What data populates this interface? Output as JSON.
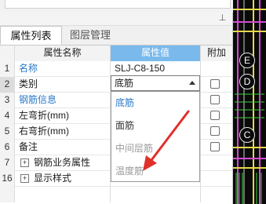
{
  "panel": {
    "pin_glyph": "⊥"
  },
  "tabs": [
    {
      "label": "属性列表",
      "active": true
    },
    {
      "label": "图层管理",
      "active": false
    }
  ],
  "columns": {
    "index": "",
    "name": "属性名称",
    "value": "属性值",
    "add": "附加"
  },
  "rows": [
    {
      "index": "1",
      "name": "名称",
      "value": "SLJ-C8-150",
      "name_color": "blue",
      "checkbox": false
    },
    {
      "index": "2",
      "name": "类别",
      "value": "底筋",
      "name_color": "normal",
      "checkbox": true
    },
    {
      "index": "3",
      "name": "钢筋信息",
      "value": "",
      "name_color": "blue",
      "checkbox": true
    },
    {
      "index": "4",
      "name": "左弯折(mm)",
      "value": "",
      "name_color": "normal",
      "checkbox": true
    },
    {
      "index": "5",
      "name": "右弯折(mm)",
      "value": "",
      "name_color": "normal",
      "checkbox": true
    },
    {
      "index": "6",
      "name": "备注",
      "value": "",
      "name_color": "normal",
      "checkbox": true
    },
    {
      "index": "7",
      "name": "钢筋业务属性",
      "value": "",
      "name_color": "normal",
      "expand": "+",
      "checkbox": false
    },
    {
      "index": "16",
      "name": "显示样式",
      "value": "",
      "name_color": "normal",
      "expand": "+",
      "checkbox": false
    }
  ],
  "dropdown": {
    "selected": "底筋",
    "options": [
      "底筋",
      "面筋",
      "中间层筋",
      "温度筋"
    ]
  },
  "canvas_markers": [
    "E",
    "D",
    "C"
  ],
  "colors": {
    "accent": "#2a78c8",
    "header_value_bg": "#79b9ec",
    "arrow": "#e0302a",
    "canvas_bg": "#0a0a0a"
  }
}
